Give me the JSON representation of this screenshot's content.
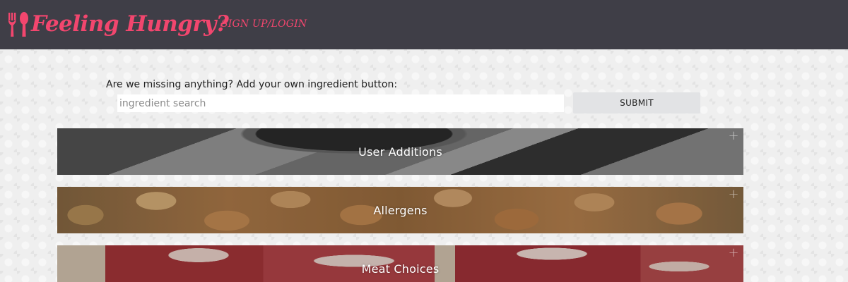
{
  "header": {
    "brand": "Feeling Hungry?",
    "brand_icon": "fork-spoon-icon",
    "nav_link": "SIGN UP/LOGIN",
    "bg_color": "#3f3e47",
    "accent_color": "#f2466e"
  },
  "add_ingredient": {
    "label": "Are we missing anything? Add your own ingredient button:",
    "input_value": "",
    "placeholder": "ingredient search",
    "submit_label": "SUBMIT"
  },
  "categories": [
    {
      "title": "User Additions",
      "expand_icon": "plus-icon"
    },
    {
      "title": "Allergens",
      "expand_icon": "plus-icon"
    },
    {
      "title": "Meat Choices",
      "expand_icon": "plus-icon"
    }
  ]
}
